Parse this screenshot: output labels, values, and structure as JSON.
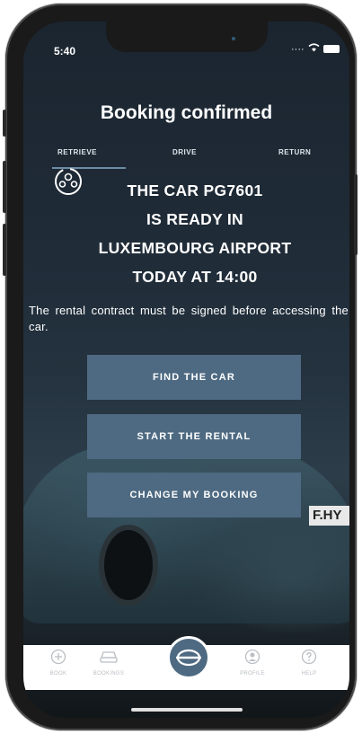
{
  "status_bar": {
    "time": "5:40"
  },
  "header": {
    "title": "Booking confirmed"
  },
  "tabs": [
    {
      "label": "RETRIEVE",
      "active": true
    },
    {
      "label": "DRIVE",
      "active": false
    },
    {
      "label": "RETURN",
      "active": false
    }
  ],
  "confirmation": {
    "line1": "THE CAR PG7601",
    "line2": "IS READY IN",
    "line3": "LUXEMBOURG AIRPORT",
    "line4": "TODAY AT 14:00",
    "note": "The rental contract must be signed before accessing the car."
  },
  "actions": {
    "find_car": "FIND THE CAR",
    "start_rental": "START THE RENTAL",
    "change_booking": "CHANGE MY BOOKING"
  },
  "bottom_nav": {
    "items": [
      {
        "label": "BOOK",
        "icon": "plus-circle-icon"
      },
      {
        "label": "BOOKINGS",
        "icon": "car-icon"
      },
      {
        "label": "PROFILE",
        "icon": "user-icon"
      },
      {
        "label": "HELP",
        "icon": "question-icon"
      }
    ],
    "center_icon": "brand-logo-icon"
  },
  "background_plate_text": "F.HY",
  "colors": {
    "accent": "#4e6a82",
    "tab_underline": "#6d8da6",
    "nav_inactive": "#b9bec3"
  }
}
